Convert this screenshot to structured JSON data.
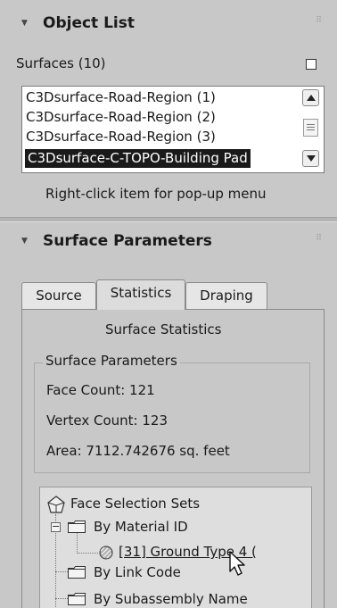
{
  "object_list": {
    "title": "Object List",
    "surfaces_label": "Surfaces (10)",
    "items": [
      "C3Dsurface-Road-Region (1)",
      "C3Dsurface-Road-Region (2)",
      "C3Dsurface-Road-Region (3)",
      "C3Dsurface-C-TOPO-Building Pad"
    ],
    "selected_index": 3,
    "hint": "Right-click item for pop-up menu"
  },
  "surface_parameters": {
    "title": "Surface Parameters",
    "tabs": [
      "Source",
      "Statistics",
      "Draping"
    ],
    "active_tab": "Statistics",
    "panel_title": "Surface Statistics",
    "group_title": "Surface Parameters",
    "face_count": "Face Count: 121",
    "vertex_count": "Vertex Count: 123",
    "area": "Area: 7112.742676 sq. feet"
  },
  "tree": {
    "root": "Face Selection Sets",
    "by_material": "By Material ID",
    "material_item": "[31] Ground Type 4 (",
    "by_link_code": "By Link Code",
    "by_subassembly": "By Subassembly Name"
  },
  "icons": {
    "rollout_arrow": "collapse-triangle-icon",
    "grip": "drag-grip-icon",
    "checkbox": "square-toggle-icon",
    "scroll_up": "up-arrow-icon",
    "scroll_down": "down-arrow-icon",
    "root": "house-icon",
    "folder": "folder-icon",
    "material": "material-sphere-icon",
    "cursor": "mouse-cursor-icon"
  },
  "colors": {
    "panel_bg": "#c8c8c8",
    "selection_bg": "#1a1a1a",
    "list_bg": "#ffffff"
  }
}
